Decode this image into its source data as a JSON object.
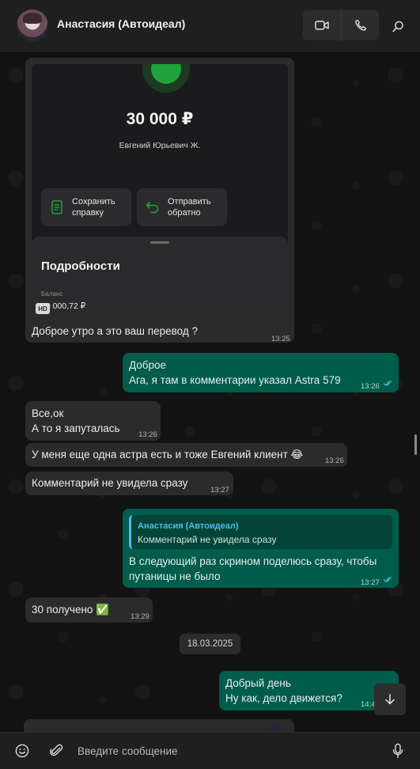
{
  "header": {
    "contact_name": "Анастасия (Автоидеал)",
    "icons": [
      "avatar",
      "video-call-icon",
      "voice-call-icon",
      "search-icon"
    ]
  },
  "image_card": {
    "amount": "30 000 ₽",
    "recipient": "Евгений Юрьевич Ж.",
    "save_label_1": "Сохранить",
    "save_label_2": "справку",
    "send_label_1": "Отправить",
    "send_label_2": "обратно",
    "details_title": "Подробности",
    "balance_label": "Баланс",
    "balance_value": "30 000,72 ₽",
    "hd_badge": "HD",
    "accent_color": "#1fa33a"
  },
  "messages": [
    {
      "dir": "in",
      "lines": [
        "Доброе утро а это ваш перевод ?"
      ],
      "time": "13:25"
    },
    {
      "dir": "out",
      "lines": [
        "Доброе",
        "Ага, я там в комментарии указал Astra 579"
      ],
      "time": "13:26",
      "read": true
    },
    {
      "dir": "in",
      "lines": [
        "Все,ок",
        "А то я запуталась"
      ],
      "time": "13:26"
    },
    {
      "dir": "in",
      "lines": [
        "У меня еще одна астра есть и тоже Евгений клиент 😂"
      ],
      "time": "13:26"
    },
    {
      "dir": "in",
      "lines": [
        "Комментарий не увидела сразу"
      ],
      "time": "13:27"
    },
    {
      "dir": "out",
      "reply_author": "Анастасия (Автоидеал)",
      "reply_text": "Комментарий не увидела сразу",
      "lines": [
        "В следующий раз скрином поделюсь сразу, чтобы",
        "путаницы не было"
      ],
      "time": "13:27",
      "read": true
    },
    {
      "dir": "in",
      "lines": [
        "30 получено ✅"
      ],
      "time": "13:29"
    },
    {
      "dir": "out",
      "lines": [
        "Добрый день",
        "Ну как, дело движется?"
      ],
      "time": "14:4"
    }
  ],
  "date_separator": "18.03.2025",
  "composer": {
    "placeholder": "Введите сообщение",
    "icons": [
      "emoji-icon",
      "attach-icon",
      "microphone-icon"
    ]
  },
  "colors": {
    "incoming": "#2b2b2b",
    "outgoing": "#005c4b",
    "read_ticks": "#53bdeb"
  }
}
